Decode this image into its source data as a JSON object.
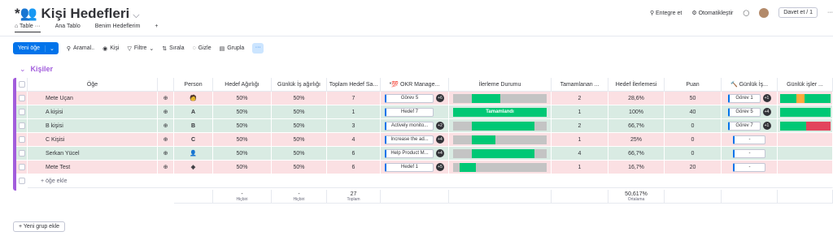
{
  "title": "Kişi Hedefleri",
  "title_prefix": "*👥",
  "tabs": [
    {
      "label": "Table"
    },
    {
      "label": "Ana Tablo"
    },
    {
      "label": "Benim Hedeflerim"
    },
    {
      "label": "+"
    }
  ],
  "right": {
    "integrate": "Entegre et",
    "automate": "Otomatikleştir",
    "invite": "Davet et / 1"
  },
  "toolbar": {
    "new_item": "Yeni öğe",
    "search": "Aramal..",
    "person": "Kişi",
    "filter": "Filtre",
    "sort": "Sırala",
    "hide": "Gizle",
    "group": "Grupla",
    "more": "···"
  },
  "group": {
    "name": "Kişiler"
  },
  "columns": [
    "Öğe",
    "Person",
    "Hedef Ağırlığı",
    "Günlük İş ağırlığı",
    "Toplam Hedef Sa...",
    "*💯 OKR Manage...",
    "İlerleme Durumu",
    "Tamamlanan ...",
    "Hedef İlerlemesi",
    "Puan",
    "🔨 Günlük İş...",
    "Günlük işler ..."
  ],
  "rows": [
    {
      "name": "Mete Uçan",
      "avatar": "🧑",
      "hedef": "50%",
      "gunluk": "50%",
      "toplam": "7",
      "okr": "Görev 5",
      "okr_badge": "+6",
      "progress": 0.3,
      "tamam": "2",
      "ilerleme": "28,6%",
      "puan": "50",
      "gunluk_is": "Görev 1",
      "gi_badge": "+1",
      "color": "pink"
    },
    {
      "name": "A kişisi",
      "avatar": "A",
      "hedef": "50%",
      "gunluk": "50%",
      "toplam": "1",
      "okr": "Hedef 7",
      "okr_badge": "",
      "progress": 1.0,
      "progress_label": "Tamamlandı",
      "tamam": "1",
      "ilerleme": "100%",
      "puan": "40",
      "gunluk_is": "Görev 5",
      "gi_badge": "+4",
      "color": "green"
    },
    {
      "name": "B kişisi",
      "avatar": "B",
      "hedef": "50%",
      "gunluk": "50%",
      "toplam": "3",
      "okr": "Actively monito...",
      "okr_badge": "+2",
      "progress": 0.67,
      "tamam": "2",
      "ilerleme": "66,7%",
      "puan": "0",
      "gunluk_is": "Görev 7",
      "gi_badge": "+1",
      "color": "green"
    },
    {
      "name": "C Kişisi",
      "avatar": "C",
      "hedef": "50%",
      "gunluk": "50%",
      "toplam": "4",
      "okr": "Increase the ad...",
      "okr_badge": "+4",
      "progress": 0.25,
      "tamam": "1",
      "ilerleme": "25%",
      "puan": "0",
      "gunluk_is": "-",
      "gi_badge": "",
      "color": "pink"
    },
    {
      "name": "Serkan Yücel",
      "avatar": "👤",
      "hedef": "50%",
      "gunluk": "50%",
      "toplam": "6",
      "okr": "Help Product M...",
      "okr_badge": "+4",
      "progress": 0.67,
      "tamam": "4",
      "ilerleme": "66,7%",
      "puan": "0",
      "gunluk_is": "-",
      "gi_badge": "",
      "color": "green"
    },
    {
      "name": "Mete Test",
      "avatar": "◈",
      "hedef": "50%",
      "gunluk": "50%",
      "toplam": "6",
      "okr": "Hedef 1",
      "okr_badge": "+5",
      "progress": 0.17,
      "tamam": "1",
      "ilerleme": "16,7%",
      "puan": "20",
      "gunluk_is": "-",
      "gi_badge": "",
      "color": "pink"
    }
  ],
  "add_item": "+ öğe ekle",
  "footer": {
    "hedef": "-",
    "hedef_sub": "Hiçbiri",
    "gunluk": "-",
    "gunluk_sub": "Hiçbiri",
    "toplam": "27",
    "toplam_sub": "Toplam",
    "ilerleme": "50,617%",
    "ilerleme_sub": "Ortalama"
  },
  "add_group": "+ Yeni grup ekle",
  "colors": {
    "accent": "#0073ea",
    "group": "#a25ddc",
    "done": "#00c875",
    "pink": "#fbe0e3",
    "green": "#d9ebe3"
  }
}
